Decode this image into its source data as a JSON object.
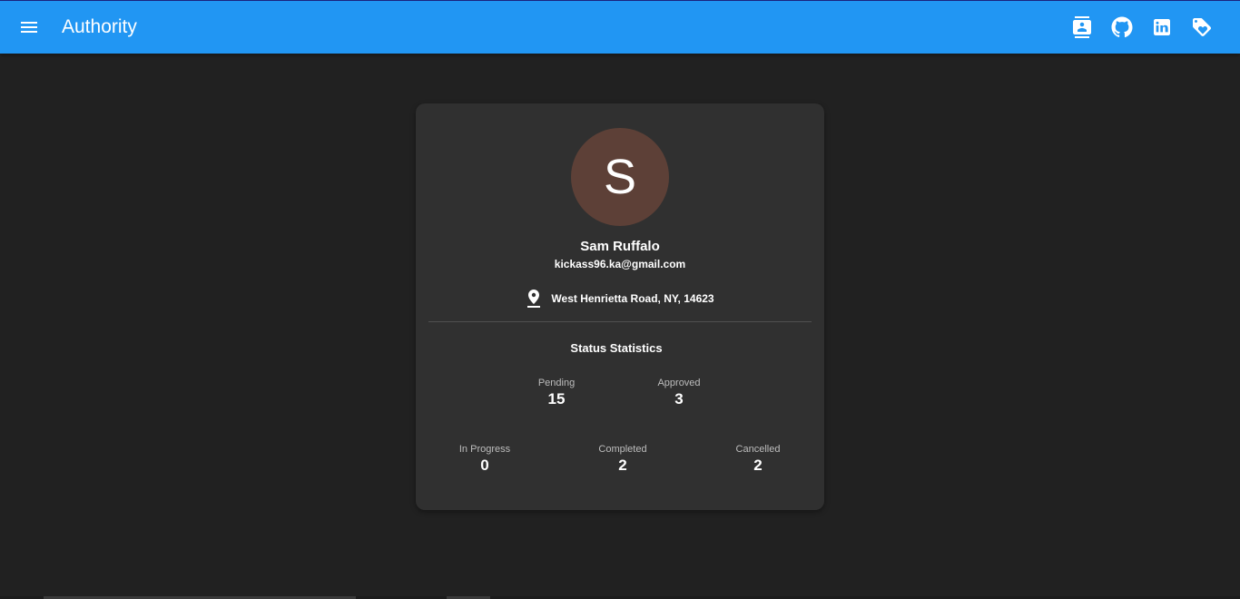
{
  "appbar": {
    "title": "Authority",
    "menu_icon": "menu-icon",
    "icons": [
      "contacts-icon",
      "github-icon",
      "linkedin-icon",
      "tag-icon"
    ],
    "color": "#2196f3"
  },
  "profile": {
    "avatar_letter": "S",
    "avatar_color": "#5d4037",
    "name": "Sam Ruffalo",
    "email": "kickass96.ka@gmail.com",
    "location_icon": "location-pin-icon",
    "address": "West Henrietta Road, NY, 14623"
  },
  "stats": {
    "title": "Status Statistics",
    "items": [
      {
        "label": "Pending",
        "value": "15"
      },
      {
        "label": "Approved",
        "value": "3"
      },
      {
        "label": "In Progress",
        "value": "0"
      },
      {
        "label": "Completed",
        "value": "2"
      },
      {
        "label": "Cancelled",
        "value": "2"
      }
    ]
  }
}
